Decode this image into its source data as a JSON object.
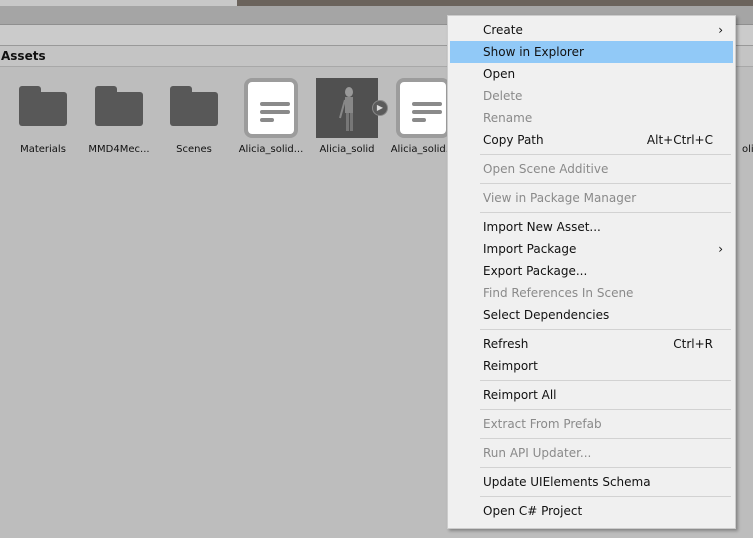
{
  "header": {
    "title": "Assets"
  },
  "assets": [
    {
      "label": "Materials",
      "type": "folder"
    },
    {
      "label": "MMD4Mec...",
      "type": "folder"
    },
    {
      "label": "Scenes",
      "type": "folder"
    },
    {
      "label": "Alicia_solid...",
      "type": "document"
    },
    {
      "label": "Alicia_solid",
      "type": "model"
    },
    {
      "label": "Alicia_solid...",
      "type": "document"
    },
    {
      "label": "olid",
      "type": "partial"
    }
  ],
  "menu": {
    "highlight_color": "#91c9f7",
    "groups": [
      [
        {
          "label": "Create",
          "submenu": true
        },
        {
          "label": "Show in Explorer",
          "highlighted": true
        },
        {
          "label": "Open"
        },
        {
          "label": "Delete",
          "disabled": true
        },
        {
          "label": "Rename",
          "disabled": true
        },
        {
          "label": "Copy Path",
          "shortcut": "Alt+Ctrl+C"
        }
      ],
      [
        {
          "label": "Open Scene Additive",
          "disabled": true
        }
      ],
      [
        {
          "label": "View in Package Manager",
          "disabled": true
        }
      ],
      [
        {
          "label": "Import New Asset..."
        },
        {
          "label": "Import Package",
          "submenu": true
        },
        {
          "label": "Export Package..."
        },
        {
          "label": "Find References In Scene",
          "disabled": true
        },
        {
          "label": "Select Dependencies"
        }
      ],
      [
        {
          "label": "Refresh",
          "shortcut": "Ctrl+R"
        },
        {
          "label": "Reimport"
        }
      ],
      [
        {
          "label": "Reimport All"
        }
      ],
      [
        {
          "label": "Extract From Prefab",
          "disabled": true
        }
      ],
      [
        {
          "label": "Run API Updater...",
          "disabled": true
        }
      ],
      [
        {
          "label": "Update UIElements Schema"
        }
      ],
      [
        {
          "label": "Open C# Project"
        }
      ]
    ]
  }
}
